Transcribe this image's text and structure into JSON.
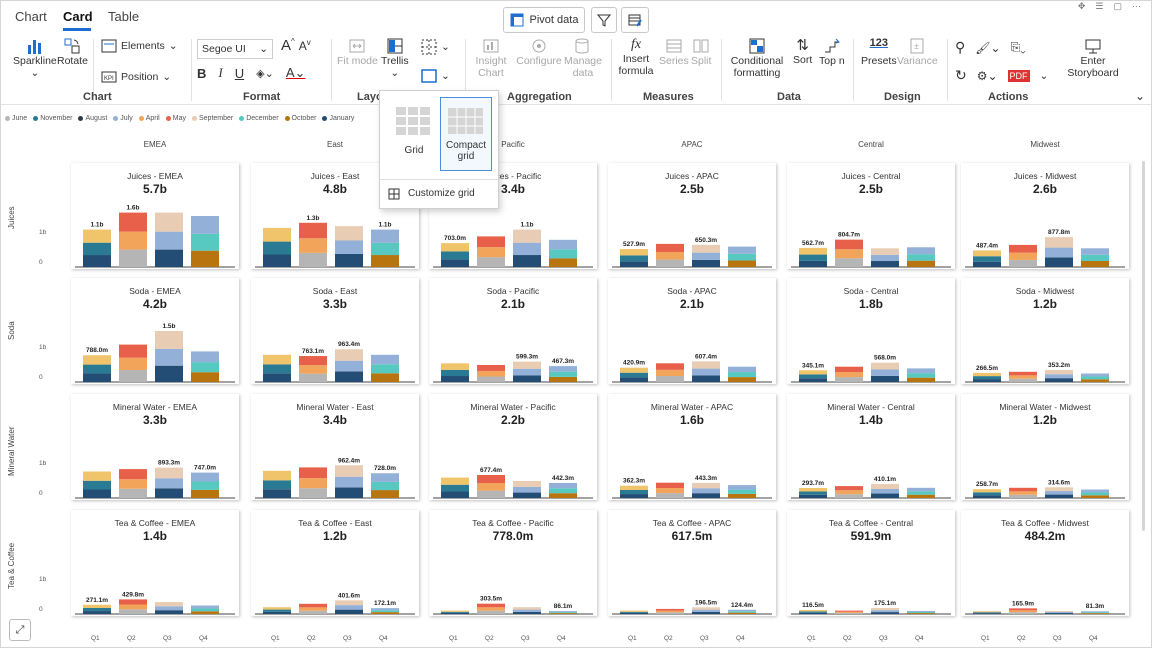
{
  "tabs": {
    "chart": "Chart",
    "card": "Card",
    "table": "Table"
  },
  "top": {
    "pivot": "Pivot data"
  },
  "ribbon": {
    "sparkline": "Sparkline",
    "rotate": "Rotate",
    "elements": "Elements",
    "position": "Position",
    "font": "Segoe UI",
    "fit_mode": "Fit mode",
    "trellis": "Trellis",
    "insight_chart": "Insight Chart",
    "configure": "Configure",
    "manage_data": "Manage data",
    "insert_formula": "Insert formula",
    "series": "Series",
    "split": "Split",
    "conditional": "Conditional formatting",
    "sort": "Sort",
    "topn": "Top n",
    "presets_icon": "123",
    "presets": "Presets",
    "variance": "Variance",
    "enter_storyboard": "Enter Storyboard",
    "groups": {
      "chart": "Chart",
      "format": "Format",
      "layout": "Layo",
      "aggregation": "Aggregation",
      "measures": "Measures",
      "data": "Data",
      "design": "Design",
      "actions": "Actions"
    }
  },
  "dropdown": {
    "grid": "Grid",
    "compact": "Compact grid",
    "customize": "Customize grid"
  },
  "legend": [
    {
      "label": "June",
      "color": "#b5b5b5"
    },
    {
      "label": "November",
      "color": "#2a7a93"
    },
    {
      "label": "August",
      "color": "#2d3946"
    },
    {
      "label": "July",
      "color": "#93b1d8"
    },
    {
      "label": "April",
      "color": "#f2a45a"
    },
    {
      "label": "May",
      "color": "#e8604a"
    },
    {
      "label": "September",
      "color": "#e8ccb3"
    },
    {
      "label": "December",
      "color": "#57c9c0"
    },
    {
      "label": "October",
      "color": "#b8750f"
    },
    {
      "label": "January",
      "color": "#234d75"
    }
  ],
  "columns": [
    "EMEA",
    "East",
    "Pacific",
    "APAC",
    "Central",
    "Midwest"
  ],
  "rows": [
    "Juices",
    "Soda",
    "Mineral Water",
    "Tea & Coffee"
  ],
  "quarters": [
    "Q1",
    "Q2",
    "Q3",
    "Q4"
  ],
  "ylabels": {
    "top": "1b",
    "bottom": "0"
  },
  "chart_data": {
    "type": "bar",
    "categories": [
      "Q1",
      "Q2",
      "Q3",
      "Q4"
    ],
    "cards": [
      {
        "title": "Juices - EMEA",
        "total": "5.7b",
        "values": [
          1.1,
          1.6,
          1.6,
          1.5
        ],
        "labels": [
          "1.1b",
          "1.6b",
          "",
          ""
        ]
      },
      {
        "title": "Juices - East",
        "total": "4.8b",
        "values": [
          1.15,
          1.3,
          1.2,
          1.1
        ],
        "labels": [
          "",
          "1.3b",
          "",
          "1.1b"
        ]
      },
      {
        "title": "Juices - Pacific",
        "total": "3.4b",
        "values": [
          0.703,
          0.9,
          1.1,
          0.8
        ],
        "labels": [
          "703.0m",
          "",
          "1.1b",
          ""
        ]
      },
      {
        "title": "Juices - APAC",
        "total": "2.5b",
        "values": [
          0.5279,
          0.68,
          0.6503,
          0.6
        ],
        "labels": [
          "527.9m",
          "",
          "650.3m",
          ""
        ]
      },
      {
        "title": "Juices - Central",
        "total": "2.5b",
        "values": [
          0.5627,
          0.8047,
          0.55,
          0.58
        ],
        "labels": [
          "562.7m",
          "804.7m",
          "",
          ""
        ]
      },
      {
        "title": "Juices - Midwest",
        "total": "2.6b",
        "values": [
          0.4874,
          0.65,
          0.8778,
          0.55
        ],
        "labels": [
          "487.4m",
          "",
          "877.8m",
          ""
        ]
      },
      {
        "title": "Soda - EMEA",
        "total": "4.2b",
        "values": [
          0.788,
          1.1,
          1.5,
          0.9
        ],
        "labels": [
          "788.0m",
          "",
          "1.5b",
          ""
        ]
      },
      {
        "title": "Soda - East",
        "total": "3.3b",
        "values": [
          0.8,
          0.7631,
          0.9634,
          0.8
        ],
        "labels": [
          "",
          "763.1m",
          "963.4m",
          ""
        ]
      },
      {
        "title": "Soda - Pacific",
        "total": "2.1b",
        "values": [
          0.55,
          0.5,
          0.5993,
          0.4673
        ],
        "labels": [
          "",
          "",
          "599.3m",
          "467.3m"
        ]
      },
      {
        "title": "Soda - APAC",
        "total": "2.1b",
        "values": [
          0.4209,
          0.55,
          0.6074,
          0.45
        ],
        "labels": [
          "420.9m",
          "",
          "607.4m",
          ""
        ]
      },
      {
        "title": "Soda - Central",
        "total": "1.8b",
        "values": [
          0.3451,
          0.45,
          0.568,
          0.4
        ],
        "labels": [
          "345.1m",
          "",
          "568.0m",
          ""
        ]
      },
      {
        "title": "Soda - Midwest",
        "total": "1.2b",
        "values": [
          0.2665,
          0.3,
          0.3532,
          0.25
        ],
        "labels": [
          "266.5m",
          "",
          "353.2m",
          ""
        ]
      },
      {
        "title": "Mineral Water - EMEA",
        "total": "3.3b",
        "values": [
          0.78,
          0.85,
          0.8933,
          0.747
        ],
        "labels": [
          "",
          "",
          "893.3m",
          "747.0m"
        ]
      },
      {
        "title": "Mineral Water - East",
        "total": "3.4b",
        "values": [
          0.8,
          0.9,
          0.9624,
          0.728
        ],
        "labels": [
          "",
          "",
          "962.4m",
          "728.0m"
        ]
      },
      {
        "title": "Mineral Water - Pacific",
        "total": "2.2b",
        "values": [
          0.6,
          0.6774,
          0.5,
          0.4423
        ],
        "labels": [
          "",
          "677.4m",
          "",
          "442.3m"
        ]
      },
      {
        "title": "Mineral Water - APAC",
        "total": "1.6b",
        "values": [
          0.3623,
          0.45,
          0.4433,
          0.38
        ],
        "labels": [
          "362.3m",
          "",
          "443.3m",
          ""
        ]
      },
      {
        "title": "Mineral Water - Central",
        "total": "1.4b",
        "values": [
          0.2937,
          0.35,
          0.4101,
          0.3
        ],
        "labels": [
          "293.7m",
          "",
          "410.1m",
          ""
        ]
      },
      {
        "title": "Mineral Water - Midwest",
        "total": "1.2b",
        "values": [
          0.2587,
          0.3,
          0.3146,
          0.25
        ],
        "labels": [
          "258.7m",
          "",
          "314.6m",
          ""
        ]
      },
      {
        "title": "Tea & Coffee - EMEA",
        "total": "1.4b",
        "values": [
          0.2711,
          0.4298,
          0.35,
          0.25
        ],
        "labels": [
          "271.1m",
          "429.8m",
          "",
          ""
        ]
      },
      {
        "title": "Tea & Coffee - East",
        "total": "1.2b",
        "values": [
          0.2,
          0.3,
          0.4016,
          0.1721
        ],
        "labels": [
          "",
          "",
          "401.6m",
          "172.1m"
        ]
      },
      {
        "title": "Tea & Coffee - Pacific",
        "total": "778.0m",
        "values": [
          0.1,
          0.3035,
          0.2,
          0.0861
        ],
        "labels": [
          "",
          "303.5m",
          "",
          "86.1m"
        ]
      },
      {
        "title": "Tea & Coffee - APAC",
        "total": "617.5m",
        "values": [
          0.1,
          0.15,
          0.1965,
          0.1244
        ],
        "labels": [
          "",
          "",
          "196.5m",
          "124.4m"
        ]
      },
      {
        "title": "Tea & Coffee - Central",
        "total": "591.9m",
        "values": [
          0.1165,
          0.1,
          0.1751,
          0.09
        ],
        "labels": [
          "116.5m",
          "",
          "175.1m",
          ""
        ]
      },
      {
        "title": "Tea & Coffee - Midwest",
        "total": "484.2m",
        "values": [
          0.08,
          0.1659,
          0.09,
          0.0813
        ],
        "labels": [
          "",
          "165.9m",
          "",
          "81.3m"
        ]
      }
    ]
  }
}
